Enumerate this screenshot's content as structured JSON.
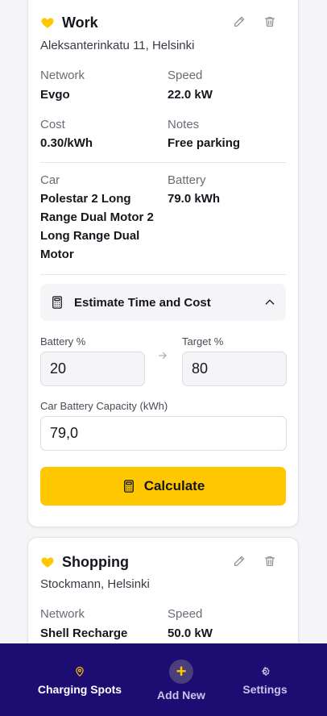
{
  "cards": [
    {
      "title": "Work",
      "address": "Aleksanterinkatu 11, Helsinki",
      "network_label": "Network",
      "network": "Evgo",
      "speed_label": "Speed",
      "speed": "22.0 kW",
      "cost_label": "Cost",
      "cost": "0.30/kWh",
      "notes_label": "Notes",
      "notes": "Free parking",
      "car_label": "Car",
      "car": "Polestar 2 Long Range Dual Motor 2 Long Range Dual Motor",
      "battery_label": "Battery",
      "battery": "79.0 kWh",
      "estimate": {
        "title": "Estimate Time and Cost",
        "battery_pct_label": "Battery %",
        "battery_pct": "20",
        "target_pct_label": "Target %",
        "target_pct": "80",
        "capacity_label": "Car Battery Capacity (kWh)",
        "capacity": "79,0",
        "calculate_label": "Calculate"
      }
    },
    {
      "title": "Shopping",
      "address": "Stockmann, Helsinki",
      "network_label": "Network",
      "network": "Shell Recharge",
      "speed_label": "Speed",
      "speed": "50.0 kW"
    }
  ],
  "nav": {
    "items": [
      {
        "label": "Charging Spots",
        "icon": "location-pin-icon",
        "active": true
      },
      {
        "label": "Add New",
        "icon": "plus-icon"
      },
      {
        "label": "Settings",
        "icon": "gear-icon"
      }
    ]
  },
  "colors": {
    "accent": "#ffc700",
    "nav_bg": "#1d0d72",
    "nav_inactive": "#c9c3ea"
  }
}
